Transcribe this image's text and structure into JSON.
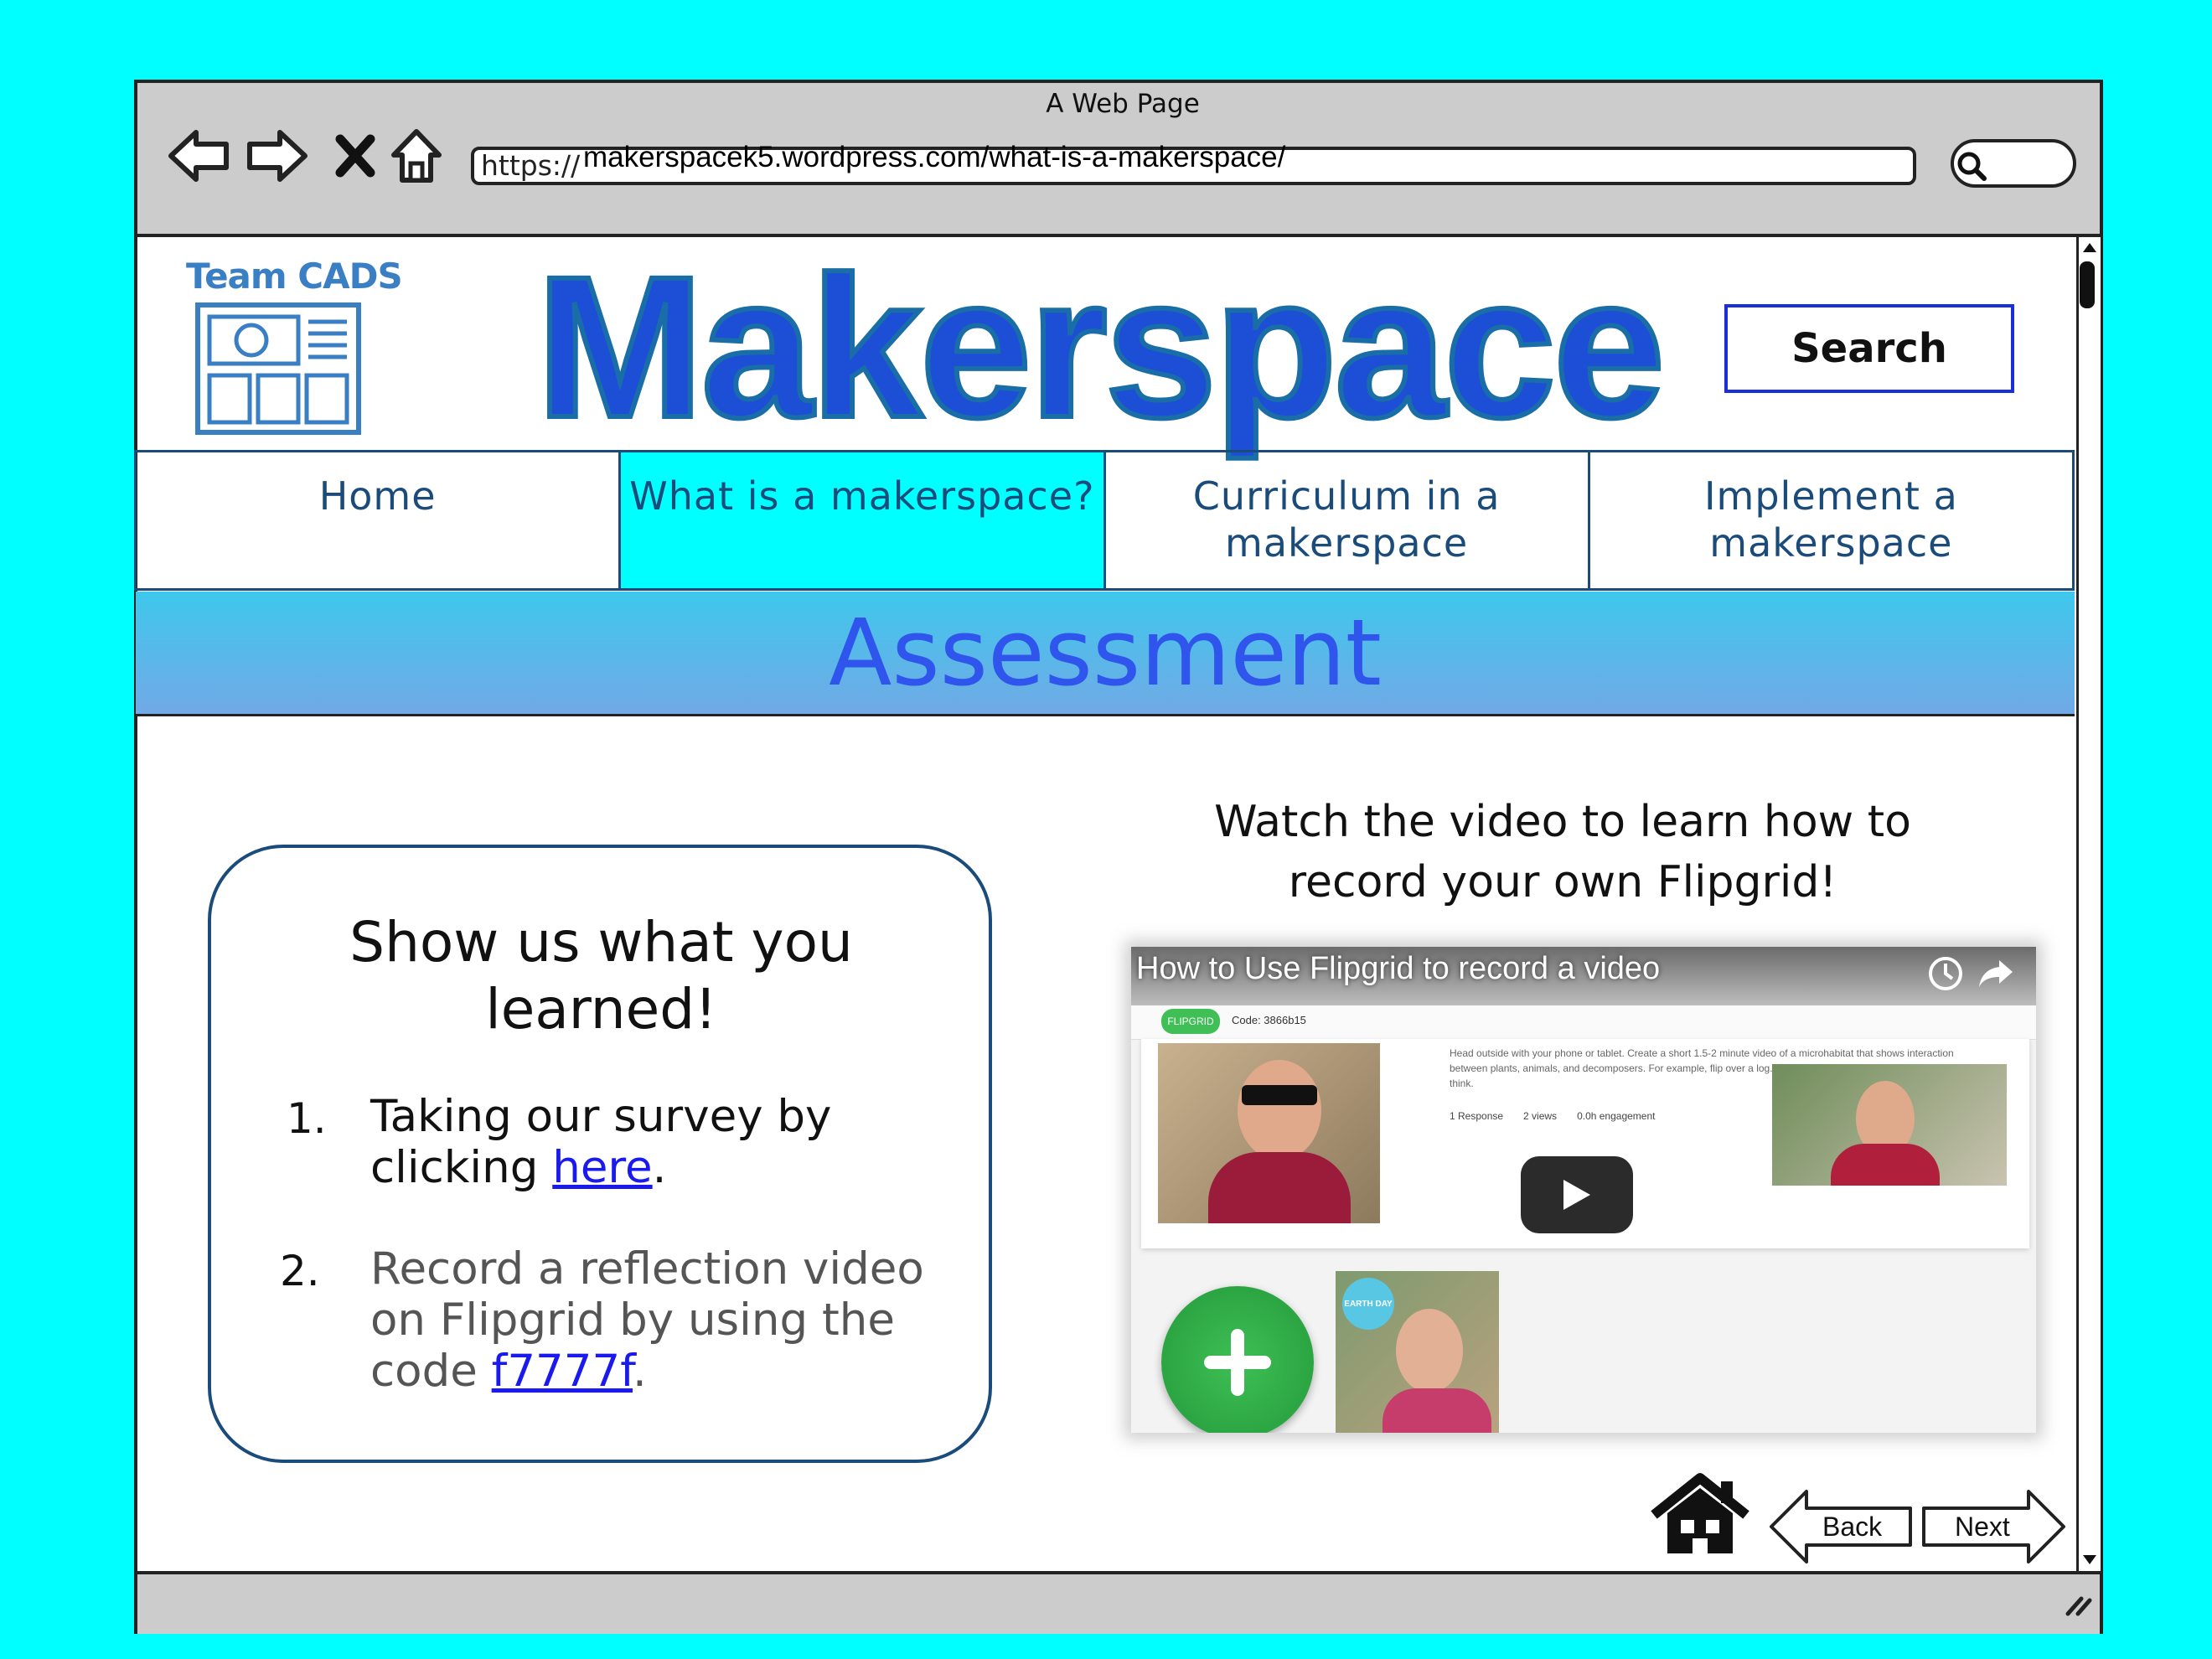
{
  "window": {
    "title": "A Web Page"
  },
  "browser": {
    "url_prefix": "https://",
    "url": "makerspacek5.wordpress.com/what-is-a-makerspace/"
  },
  "header": {
    "team_label": "Team CADS",
    "page_title": "Makerspace",
    "search_label": "Search"
  },
  "nav": {
    "items": [
      {
        "label": "Home"
      },
      {
        "label": "What is a makerspace?"
      },
      {
        "label": "Curriculum in a makerspace"
      },
      {
        "label": "Implement a makerspace"
      }
    ]
  },
  "section": {
    "title": "Assessment"
  },
  "card": {
    "heading": "Show us what you learned!",
    "items": [
      {
        "number": "1.",
        "text_before": "Taking our survey by clicking ",
        "link": "here",
        "text_after": "."
      },
      {
        "number": "2.",
        "text_before": "Record a reflection video on Flipgrid by using the code ",
        "link": "f7777f",
        "text_after": "."
      }
    ]
  },
  "video": {
    "caption": "Watch the video to learn how to record your own Flipgrid!",
    "title": "How to Use Flipgrid to record a video",
    "brand": "FLIPGRID",
    "code": "Code: 3866b15",
    "description": "Head outside with your phone or tablet. Create a short 1.5-2 minute video of a microhabitat that shows interaction between plants, animals, and decomposers. For example, flip over a log. You get the idea! Talk about what you see or think.",
    "stats": [
      "1 Response",
      "2 views",
      "0.0h engagement"
    ],
    "badge": "EARTH DAY"
  },
  "footer": {
    "back_label": "Back",
    "next_label": "Next"
  },
  "colors": {
    "background": "#00ffff",
    "title_blue": "#1c4fd6",
    "nav_text": "#1a4b7a",
    "active_tab": "#00ffff",
    "banner_text": "#2f55ec",
    "link": "#1a1aee"
  }
}
